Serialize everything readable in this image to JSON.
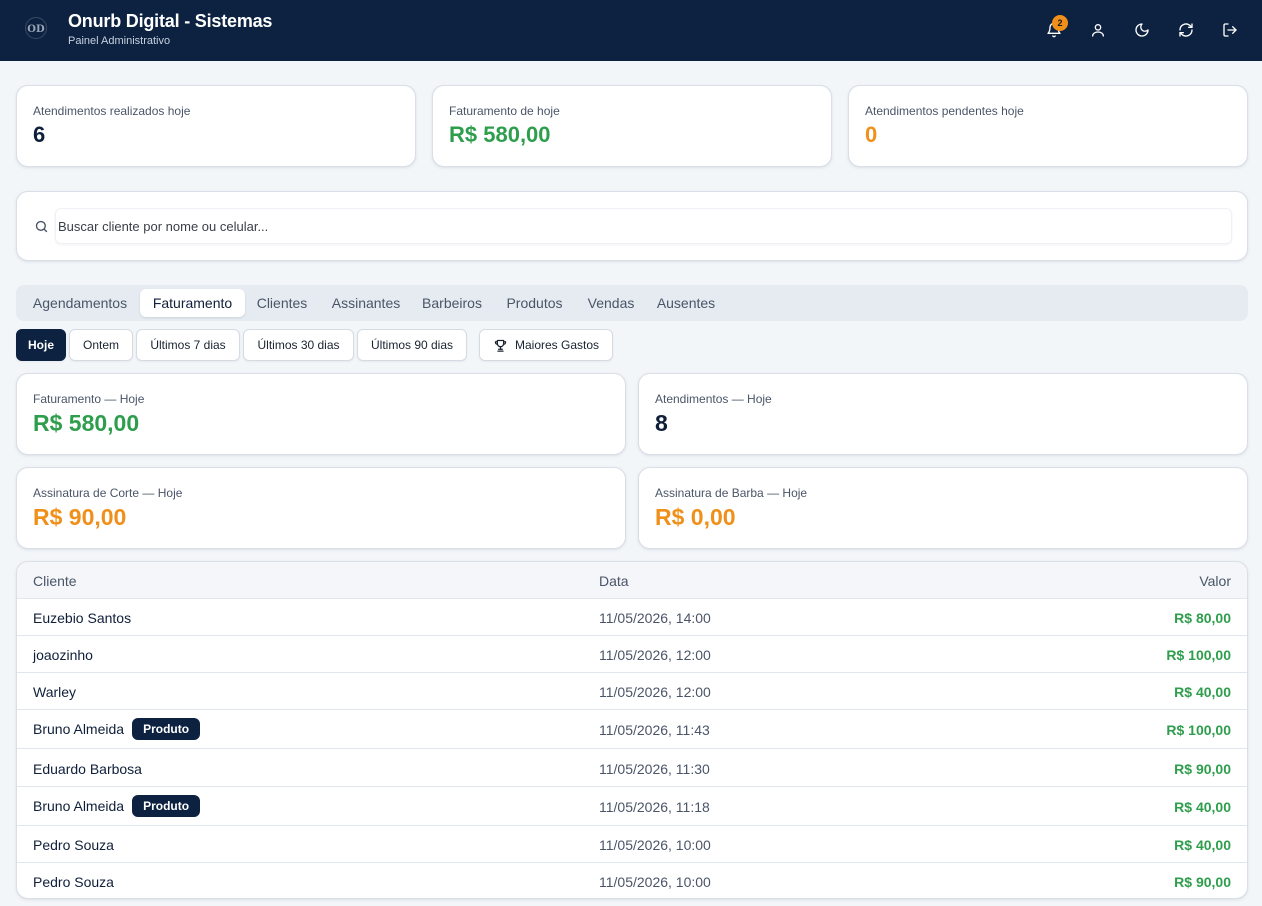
{
  "header": {
    "title": "Onurb Digital - Sistemas",
    "subtitle": "Painel Administrativo",
    "notifications_count": "2",
    "icons": [
      "bell-icon",
      "user-icon",
      "moon-icon",
      "refresh-icon",
      "logout-icon"
    ]
  },
  "stats": [
    {
      "label": "Atendimentos realizados hoje",
      "value": "6",
      "color": "#0f1f3a"
    },
    {
      "label": "Faturamento de hoje",
      "value": "R$ 580,00",
      "color": "#2e9e4d"
    },
    {
      "label": "Atendimentos pendentes hoje",
      "value": "0",
      "color": "#f0901a"
    }
  ],
  "search": {
    "placeholder": "Buscar cliente por nome ou celular..."
  },
  "tabs": [
    "Agendamentos",
    "Faturamento",
    "Clientes",
    "Assinantes",
    "Barbeiros",
    "Produtos",
    "Vendas",
    "Ausentes"
  ],
  "active_tab": "Faturamento",
  "filters": [
    "Hoje",
    "Ontem",
    "Últimos 7 dias",
    "Últimos 30 dias",
    "Últimos 90 dias"
  ],
  "active_filter": "Hoje",
  "top_spenders_label": "Maiores Gastos",
  "summary": [
    {
      "label": "Faturamento — Hoje",
      "value": "R$ 580,00",
      "color": "#2e9e4d"
    },
    {
      "label": "Atendimentos — Hoje",
      "value": "8",
      "color": "#0f1f3a"
    },
    {
      "label": "Assinatura de Corte — Hoje",
      "value": "R$ 90,00",
      "color": "#f0901a"
    },
    {
      "label": "Assinatura de Barba — Hoje",
      "value": "R$ 0,00",
      "color": "#f0901a"
    }
  ],
  "table": {
    "headers": {
      "client": "Cliente",
      "date": "Data",
      "value": "Valor"
    },
    "product_badge": "Produto",
    "rows": [
      {
        "client": "Euzebio Santos",
        "date": "11/05/2026, 14:00",
        "value": "R$ 80,00",
        "product": false
      },
      {
        "client": "joaozinho",
        "date": "11/05/2026, 12:00",
        "value": "R$ 100,00",
        "product": false
      },
      {
        "client": "Warley",
        "date": "11/05/2026, 12:00",
        "value": "R$ 40,00",
        "product": false
      },
      {
        "client": "Bruno Almeida",
        "date": "11/05/2026, 11:43",
        "value": "R$ 100,00",
        "product": true
      },
      {
        "client": "Eduardo Barbosa",
        "date": "11/05/2026, 11:30",
        "value": "R$ 90,00",
        "product": false
      },
      {
        "client": "Bruno Almeida",
        "date": "11/05/2026, 11:18",
        "value": "R$ 40,00",
        "product": true
      },
      {
        "client": "Pedro Souza",
        "date": "11/05/2026, 10:00",
        "value": "R$ 40,00",
        "product": false
      },
      {
        "client": "Pedro Souza",
        "date": "11/05/2026, 10:00",
        "value": "R$ 90,00",
        "product": false
      }
    ]
  }
}
